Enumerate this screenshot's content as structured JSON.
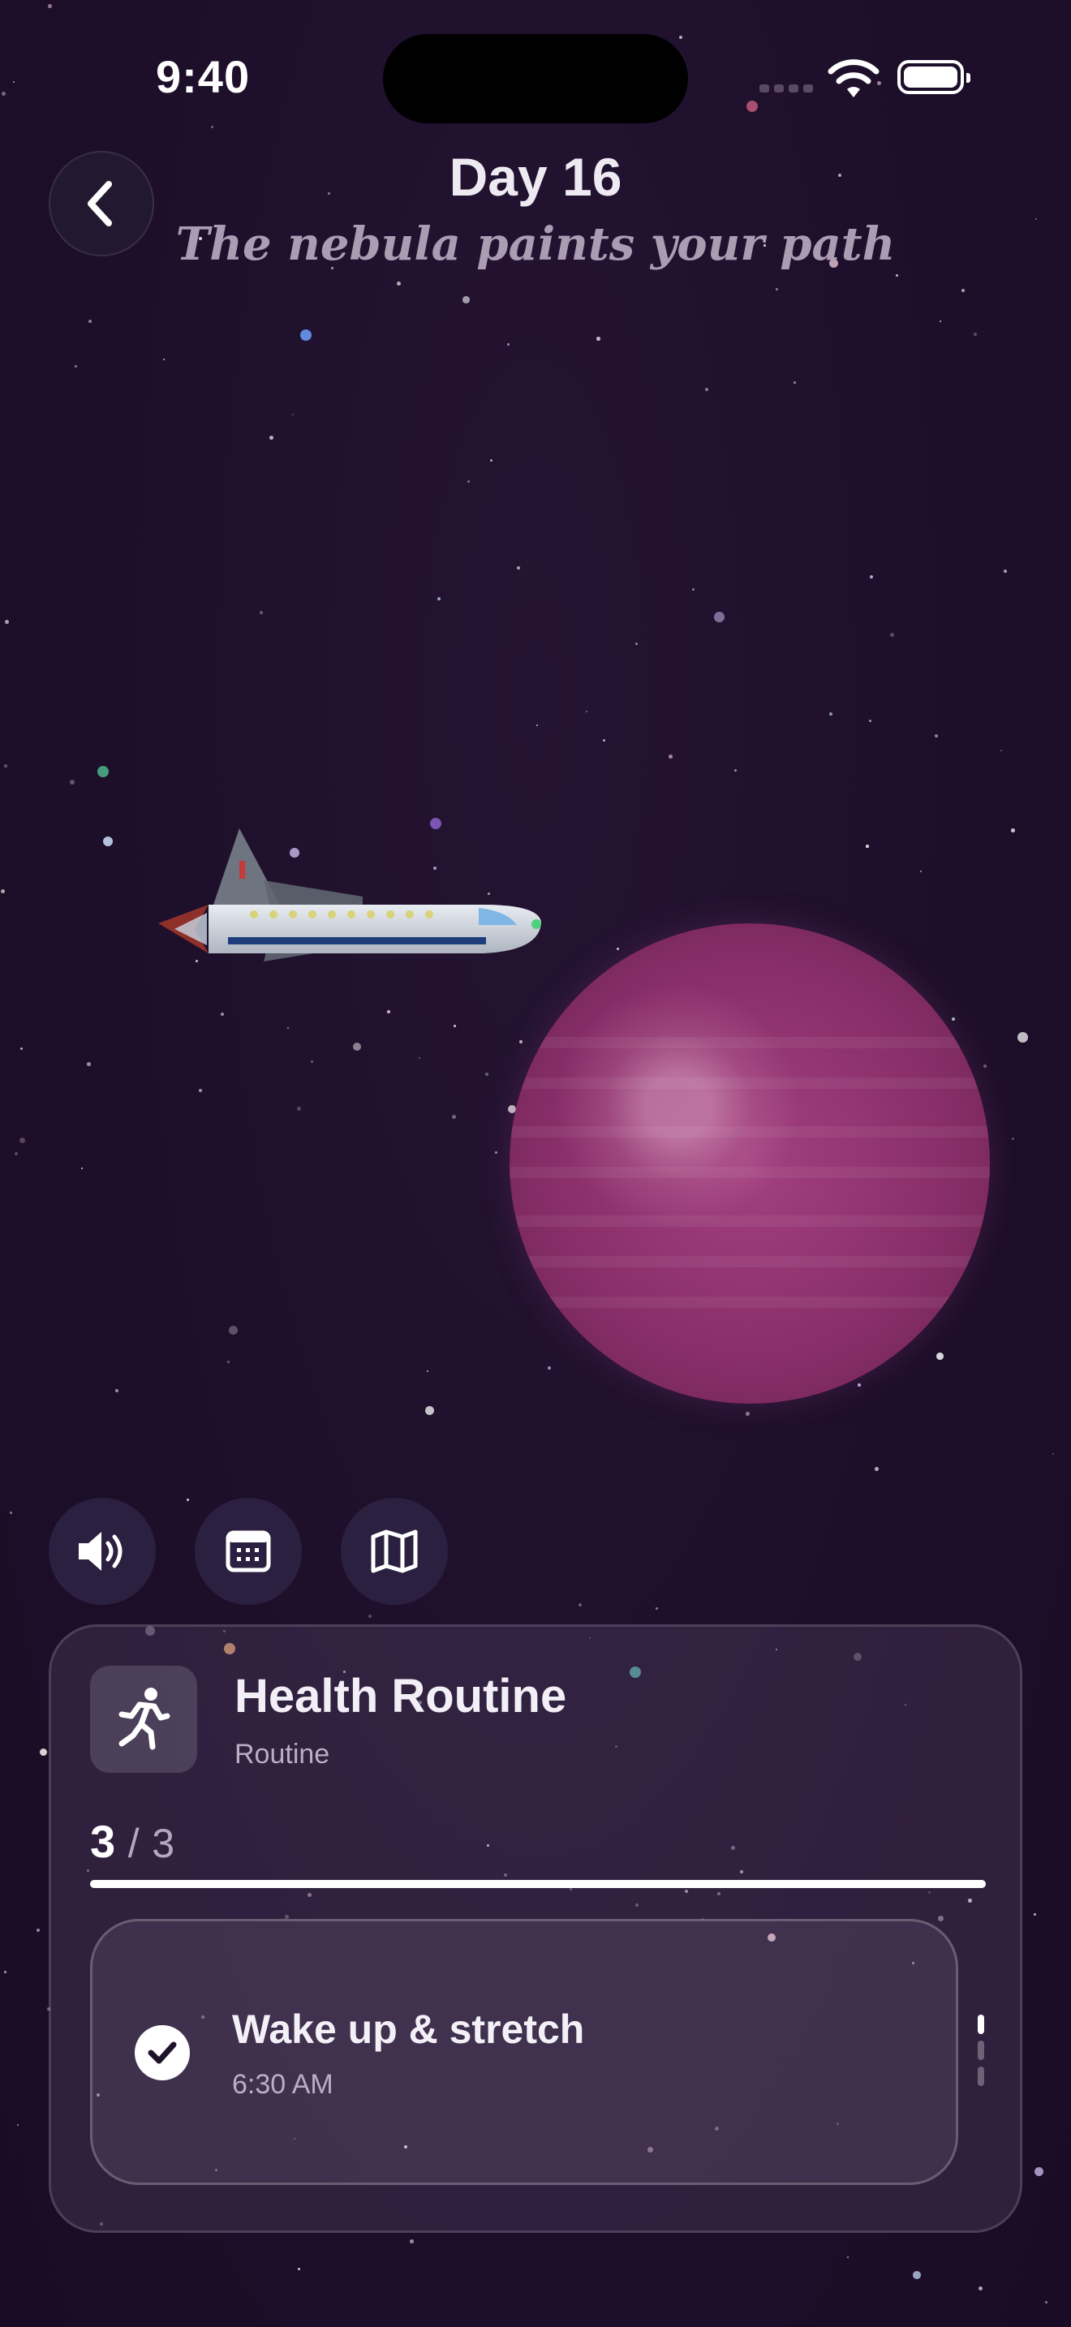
{
  "status_bar": {
    "time": "9:40"
  },
  "header": {
    "title": "Day 16",
    "subtitle": "The nebula paints your path"
  },
  "controls": [
    "speaker-icon",
    "calendar-icon",
    "map-icon"
  ],
  "routine_card": {
    "title": "Health Routine",
    "category": "Routine",
    "progress": {
      "completed": "3",
      "separator": "/",
      "total": "3",
      "fraction": 1.0
    },
    "current_task": {
      "title": "Wake up & stretch",
      "time": "6:30 AM",
      "done": true
    },
    "pager": {
      "count": 3,
      "active_index": 0
    }
  },
  "colors": {
    "background": "#1d0f2a",
    "planet": "#a2417f",
    "accent": "#ffffff"
  }
}
